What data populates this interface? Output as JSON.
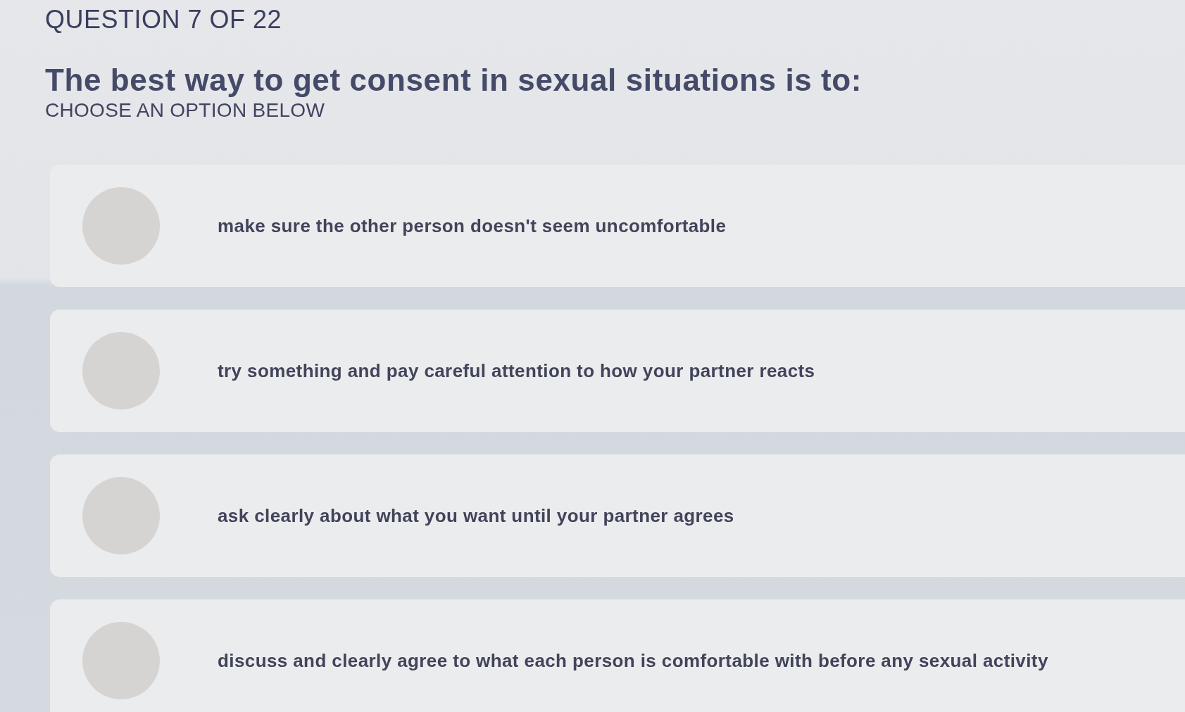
{
  "header": {
    "progress": "QUESTION 7 OF 22"
  },
  "question": {
    "text": "The best way to get consent in sexual situations is to:",
    "instruction": "CHOOSE AN OPTION BELOW"
  },
  "options": [
    {
      "label": "make sure the other person doesn't seem uncomfortable",
      "selected": false
    },
    {
      "label": "try something and pay careful attention to how your partner reacts",
      "selected": false
    },
    {
      "label": "ask clearly about what you want until your partner agrees",
      "selected": false
    },
    {
      "label": "discuss and clearly agree to what each person is comfortable with before any sexual activity",
      "selected": false
    }
  ]
}
